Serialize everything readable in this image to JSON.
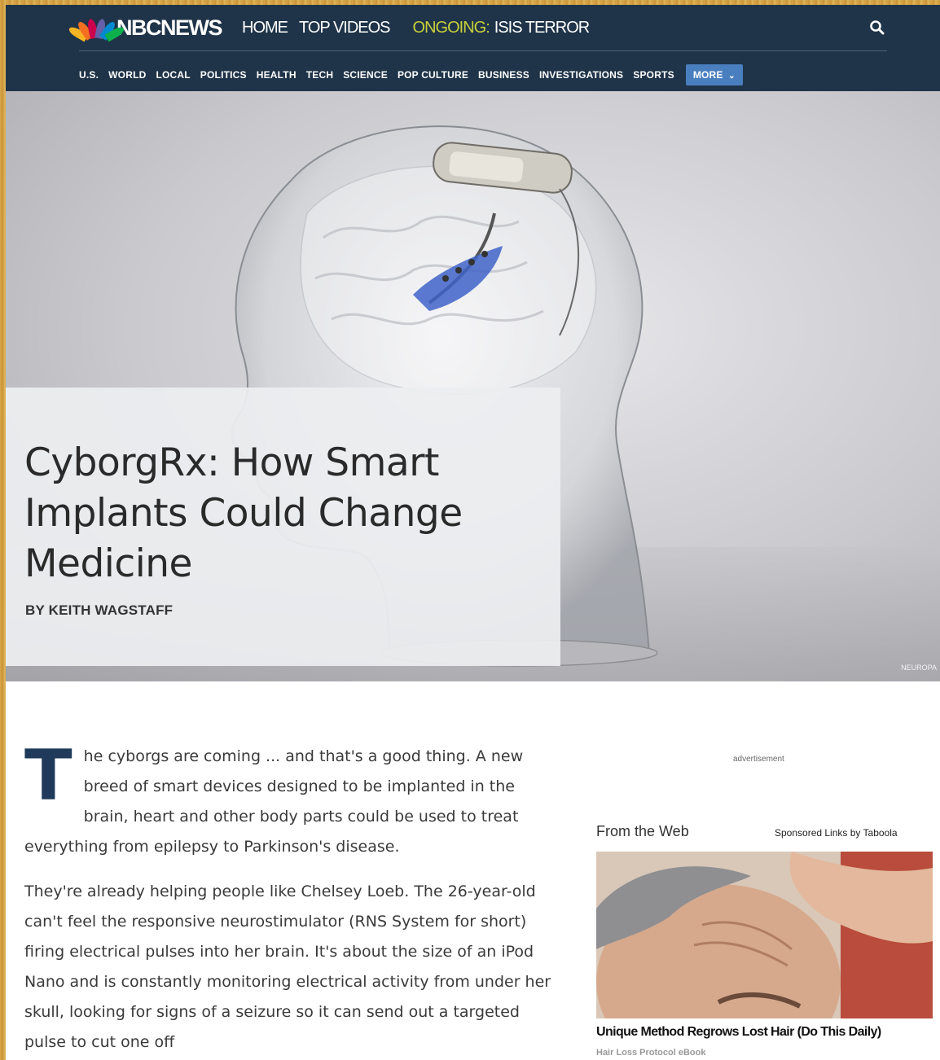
{
  "header": {
    "logo_text": "NBCNEWS",
    "topnav": [
      "HOME",
      "TOP VIDEOS"
    ],
    "ongoing_label": "ONGOING:",
    "ongoing_topic": "ISIS TERROR",
    "subnav": [
      "U.S.",
      "WORLD",
      "LOCAL",
      "POLITICS",
      "HEALTH",
      "TECH",
      "SCIENCE",
      "POP CULTURE",
      "BUSINESS",
      "INVESTIGATIONS",
      "SPORTS"
    ],
    "more_label": "MORE",
    "colors": {
      "bg": "#1f3449",
      "ongoing": "#c7cf3a",
      "more_button": "#4a7fbf"
    }
  },
  "hero": {
    "title": "CyborgRx: How Smart Implants Could Change Medicine",
    "byline": "BY KEITH WAGSTAFF",
    "credit": "NEUROPA"
  },
  "article": {
    "dropcap": "T",
    "p1_rest": "he cyborgs are coming ... and that's a good thing. A new breed of smart devices designed to be implanted in the brain, heart and other body parts could be used to treat everything from epilepsy to Parkinson's disease.",
    "p2": "They're already helping people like Chelsey Loeb. The 26-year-old can't feel the responsive neurostimulator (RNS System for short) firing electrical pulses into her brain. It's about the size of an iPod Nano and is constantly monitoring electrical activity from under her skull, looking for signs of a seizure so it can send out a targeted pulse to cut one off"
  },
  "sidebar": {
    "ad_label": "advertisement",
    "from_web": "From the Web",
    "sponsored": "Sponsored Links by Taboola",
    "ad_title": "Unique Method Regrows Lost Hair (Do This Daily)",
    "ad_source": "Hair Loss Protocol eBook"
  },
  "icons": {
    "search": "search-icon",
    "chevron": "chevron-down-icon",
    "logo": "peacock-logo-icon"
  }
}
